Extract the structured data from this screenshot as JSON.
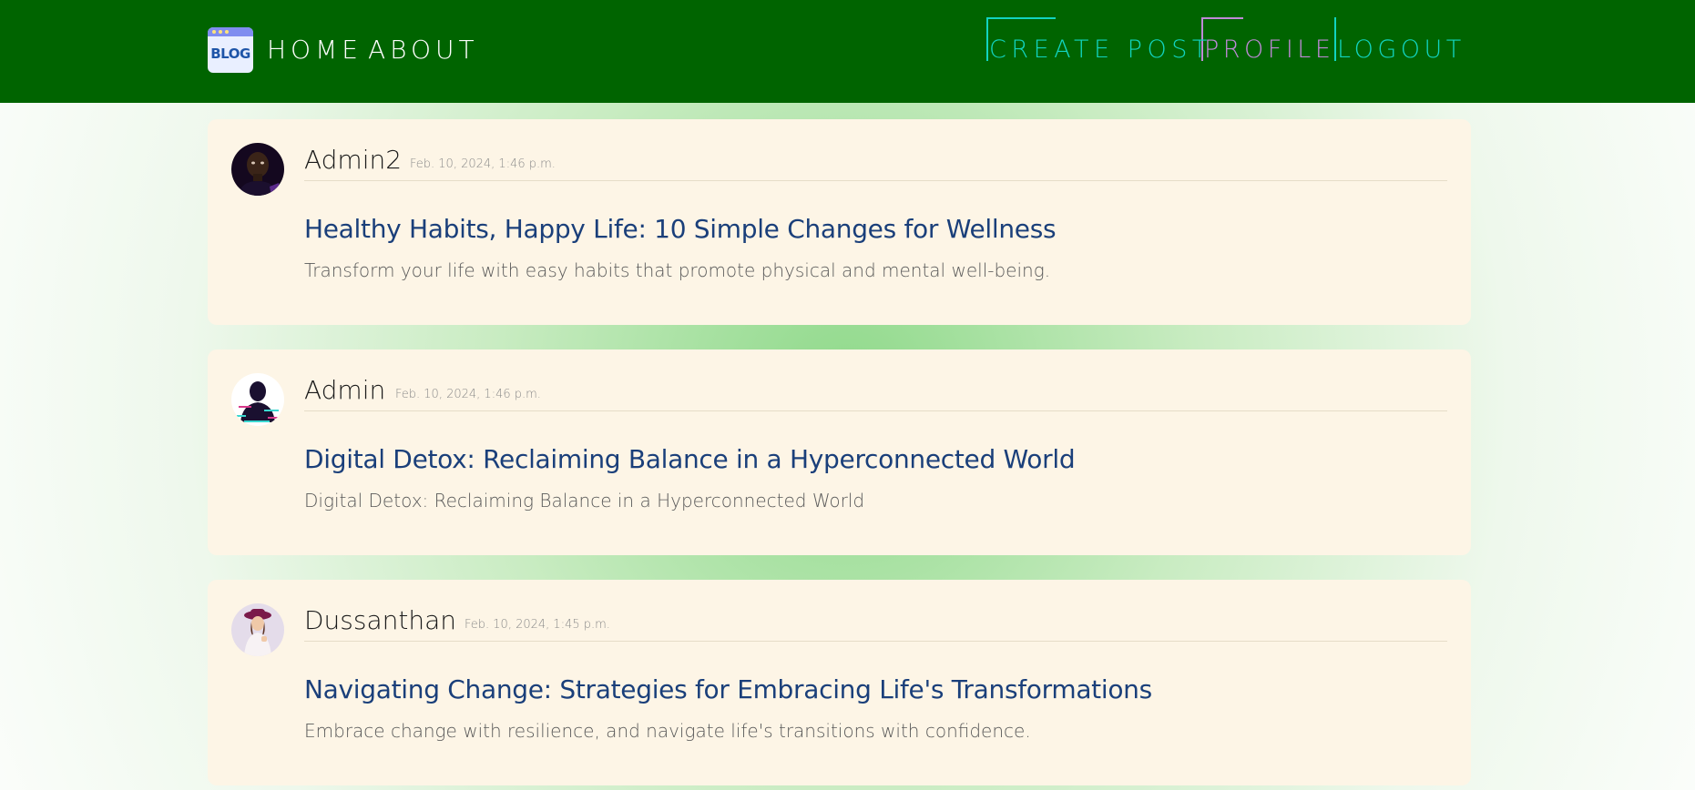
{
  "nav": {
    "logo_text": "BLOG",
    "home": "HOME",
    "about": "ABOUT",
    "create_post": "CREATE POST",
    "profile": "PROFILE",
    "logout": "LOGOUT"
  },
  "colors": {
    "navbar": "#006400",
    "card": "#fdf5e6",
    "title": "#1a3f7a",
    "nav_accent": "#12d4c0",
    "profile_accent": "#c08ad8"
  },
  "posts": [
    {
      "author": "Admin2",
      "date": "Feb. 10, 2024, 1:46 p.m.",
      "title": "Healthy Habits, Happy Life: 10 Simple Changes for Wellness",
      "excerpt": "Transform your life with easy habits that promote physical and mental well-being.",
      "avatar_icon": "avatar-dark-portrait"
    },
    {
      "author": "Admin",
      "date": "Feb. 10, 2024, 1:46 p.m.",
      "title": "Digital Detox: Reclaiming Balance in a Hyperconnected World",
      "excerpt": "Digital Detox: Reclaiming Balance in a Hyperconnected World",
      "avatar_icon": "avatar-glitch-silhouette"
    },
    {
      "author": "Dussanthan",
      "date": "Feb. 10, 2024, 1:45 p.m.",
      "title": "Navigating Change: Strategies for Embracing Life's Transformations",
      "excerpt": "Embrace change with resilience, and navigate life's transitions with confidence.",
      "avatar_icon": "avatar-woman-hat"
    }
  ]
}
